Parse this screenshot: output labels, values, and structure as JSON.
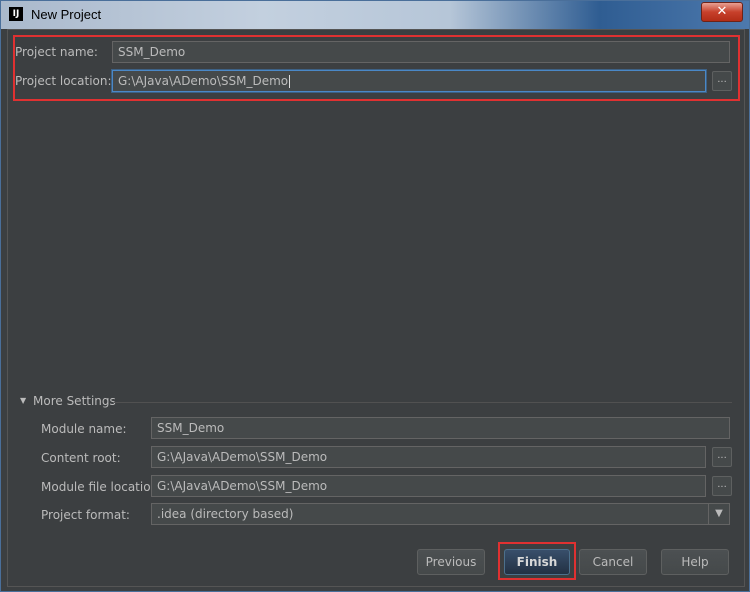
{
  "window": {
    "title": "New Project",
    "app_icon_text": "IJ",
    "close_glyph": "✕"
  },
  "project": {
    "name_label": "Project name:",
    "name_value": "SSM_Demo",
    "location_label": "Project location:",
    "location_value": "G:\\AJava\\ADemo\\SSM_Demo",
    "browse_glyph": "..."
  },
  "more_settings": {
    "toggle_glyph": "▼",
    "label": "More Settings",
    "module_name_label": "Module name:",
    "module_name_value": "SSM_Demo",
    "content_root_label": "Content root:",
    "content_root_value": "G:\\AJava\\ADemo\\SSM_Demo",
    "module_file_location_label": "Module file location:",
    "module_file_location_value": "G:\\AJava\\ADemo\\SSM_Demo",
    "project_format_label": "Project format:",
    "project_format_value": ".idea (directory based)",
    "dropdown_glyph": "▼"
  },
  "buttons": {
    "previous": "Previous",
    "finish": "Finish",
    "cancel": "Cancel",
    "help": "Help"
  },
  "colors": {
    "dialog_bg": "#3c3f41",
    "highlight": "#e03131",
    "focus": "#4a88c7"
  }
}
